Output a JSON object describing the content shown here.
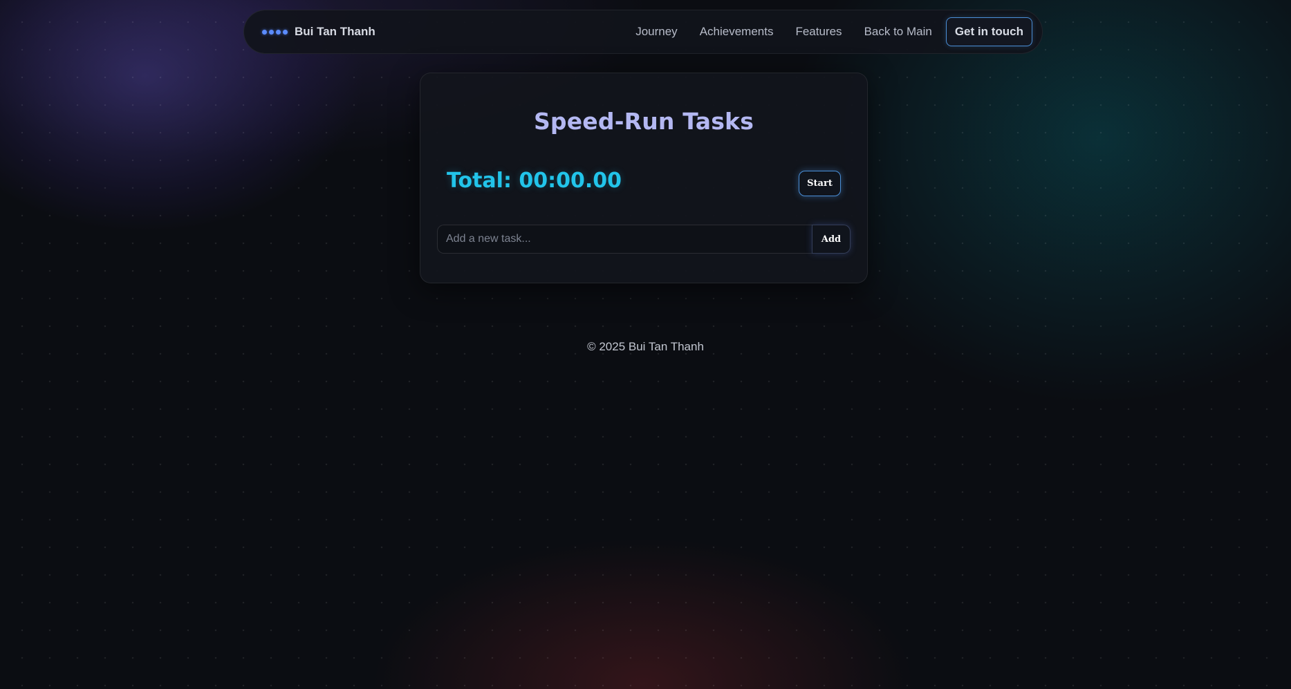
{
  "colors": {
    "accent_cyan": "#22c4ea",
    "title_lavender": "#b4b8f2",
    "brand_blue": "#5b8cff",
    "button_border": "#4a8fd8",
    "background": "#0b0d12"
  },
  "nav": {
    "brand_icon": "four-dots-icon",
    "brand_name": "Bui Tan Thanh",
    "links": [
      {
        "label": "Journey"
      },
      {
        "label": "Achievements"
      },
      {
        "label": "Features"
      },
      {
        "label": "Back to Main"
      }
    ],
    "cta_label": "Get in touch"
  },
  "card": {
    "title": "Speed-Run Tasks",
    "total_label": "Total: 00:00.00",
    "start_label": "Start",
    "task_input": {
      "value": "",
      "placeholder": "Add a new task..."
    },
    "add_label": "Add"
  },
  "footer": {
    "text": "© 2025 Bui Tan Thanh"
  }
}
